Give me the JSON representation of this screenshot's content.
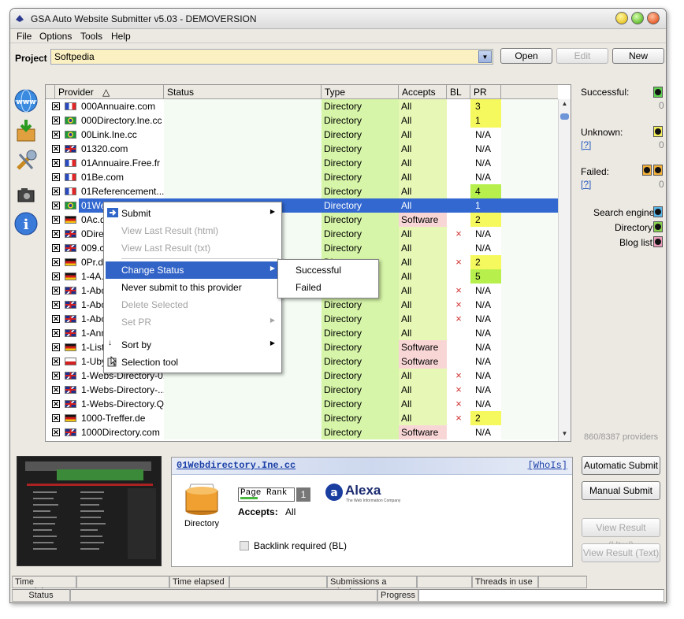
{
  "window": {
    "title": "GSA Auto Website Submitter v5.03 - DEMOVERSION"
  },
  "menu": [
    "File",
    "Options",
    "Tools",
    "Help"
  ],
  "project": {
    "label": "Project",
    "value": "Softpedia",
    "open_label": "Open",
    "edit_label": "Edit",
    "new_label": "New"
  },
  "grid": {
    "headers": [
      "Provider",
      "Status",
      "Type",
      "Accepts",
      "BL",
      "PR"
    ],
    "sort_indicator": "△",
    "rows": [
      {
        "name": "000Annuaire.com",
        "flag": "fr",
        "type": "Directory",
        "accepts": "All",
        "bl": "",
        "pr": "3"
      },
      {
        "name": "000Directory.Ine.cc",
        "flag": "br",
        "type": "Directory",
        "accepts": "All",
        "bl": "",
        "pr": "1"
      },
      {
        "name": "00Link.Ine.cc",
        "flag": "br",
        "type": "Directory",
        "accepts": "All",
        "bl": "",
        "pr": "N/A"
      },
      {
        "name": "01320.com",
        "flag": "uk",
        "type": "Directory",
        "accepts": "All",
        "bl": "",
        "pr": "N/A"
      },
      {
        "name": "01Annuaire.Free.fr",
        "flag": "fr",
        "type": "Directory",
        "accepts": "All",
        "bl": "",
        "pr": "N/A"
      },
      {
        "name": "01Be.com",
        "flag": "fr",
        "type": "Directory",
        "accepts": "All",
        "bl": "",
        "pr": "N/A"
      },
      {
        "name": "01Referencement....",
        "flag": "fr",
        "type": "Directory",
        "accepts": "All",
        "bl": "",
        "pr": "4"
      },
      {
        "name": "01We",
        "flag": "br",
        "type": "Directory",
        "accepts": "All",
        "bl": "",
        "pr": "1",
        "selected": true
      },
      {
        "name": "0Ac.d",
        "flag": "de",
        "type": "Directory",
        "accepts": "Software",
        "bl": "",
        "pr": "2"
      },
      {
        "name": "0Direc",
        "flag": "uk",
        "type": "Directory",
        "accepts": "All",
        "bl": "×",
        "pr": "N/A"
      },
      {
        "name": "009.c",
        "flag": "uk",
        "type": "Directory",
        "accepts": "All",
        "bl": "",
        "pr": "N/A"
      },
      {
        "name": "0Pr.de",
        "flag": "de",
        "type": "Directory",
        "accepts": "All",
        "bl": "×",
        "pr": "2"
      },
      {
        "name": "1-4A.c",
        "flag": "de",
        "type": "Directory",
        "accepts": "All",
        "bl": "",
        "pr": "5"
      },
      {
        "name": "1-Abc",
        "flag": "uk",
        "type": "Directory",
        "accepts": "All",
        "bl": "×",
        "pr": "N/A"
      },
      {
        "name": "1-Abc",
        "flag": "uk",
        "type": "Directory",
        "accepts": "All",
        "bl": "×",
        "pr": "N/A"
      },
      {
        "name": "1-Abc",
        "flag": "uk",
        "type": "Directory",
        "accepts": "All",
        "bl": "×",
        "pr": "N/A"
      },
      {
        "name": "1-Ann",
        "flag": "uk",
        "type": "Directory",
        "accepts": "All",
        "bl": "",
        "pr": "N/A"
      },
      {
        "name": "1-Liste",
        "flag": "de",
        "type": "Directory",
        "accepts": "Software",
        "bl": "",
        "pr": "N/A"
      },
      {
        "name": "1-Uby",
        "flag": "cz",
        "type": "Directory",
        "accepts": "Software",
        "bl": "",
        "pr": "N/A"
      },
      {
        "name": "1-Webs-Directory-0...",
        "flag": "uk",
        "type": "Directory",
        "accepts": "All",
        "bl": "×",
        "pr": "N/A"
      },
      {
        "name": "1-Webs-Directory-...",
        "flag": "uk",
        "type": "Directory",
        "accepts": "All",
        "bl": "×",
        "pr": "N/A"
      },
      {
        "name": "1-Webs-Directory.Q...",
        "flag": "uk",
        "type": "Directory",
        "accepts": "All",
        "bl": "×",
        "pr": "N/A"
      },
      {
        "name": "1000-Treffer.de",
        "flag": "de",
        "type": "Directory",
        "accepts": "All",
        "bl": "×",
        "pr": "2"
      },
      {
        "name": "1000Directory.com",
        "flag": "uk",
        "type": "Directory",
        "accepts": "Software",
        "bl": "",
        "pr": "N/A"
      }
    ]
  },
  "context_menu": {
    "items": [
      "Submit",
      "View Last Result (html)",
      "View Last Result (txt)",
      "Change Status",
      "Never submit to this provider",
      "Delete Selected",
      "Set PR",
      "Sort by",
      "Selection tool"
    ],
    "submenu": [
      "Successful",
      "Failed"
    ]
  },
  "right_panel": {
    "successful": "Successful:",
    "successful_count": "0",
    "unknown": "Unknown:",
    "unknown_count": "0",
    "unknown_help": "[?]",
    "failed": "Failed:",
    "failed_count": "0",
    "failed_help": "[?]",
    "search_engine": "Search engine",
    "directory": "Directory",
    "blog_list": "Blog list",
    "provider_count": "860/8387 providers"
  },
  "detail": {
    "name": "01Webdirectory.Ine.cc",
    "whois": "[WhoIs]",
    "type": "Directory",
    "page_rank_label": "Page Rank",
    "page_rank": "1",
    "accepts_label": "Accepts:",
    "accepts": "All",
    "alexa": "Alexa",
    "alexa_sub": "The Web Information Company",
    "backlink": "Backlink required (BL)"
  },
  "actions": {
    "auto_submit": "Automatic Submit",
    "manual_submit": "Manual Submit",
    "view_html": "View Result (Html)",
    "view_text": "View Result (Text)"
  },
  "statusbar": {
    "time_remaining": "Time remaining",
    "time_elapsed": "Time elapsed",
    "submissions": "Submissions a minute",
    "threads": "Threads in use",
    "status": "Status",
    "progress": "Progress"
  },
  "colors": {
    "type_bg": "#d6f5a8",
    "accepts_bg": "#e7f7b6",
    "software_bg": "#f9d6d6",
    "pr_bg": "#f6f95e",
    "pr_high_bg": "#b7ef4d",
    "selected": "#3268d0"
  }
}
